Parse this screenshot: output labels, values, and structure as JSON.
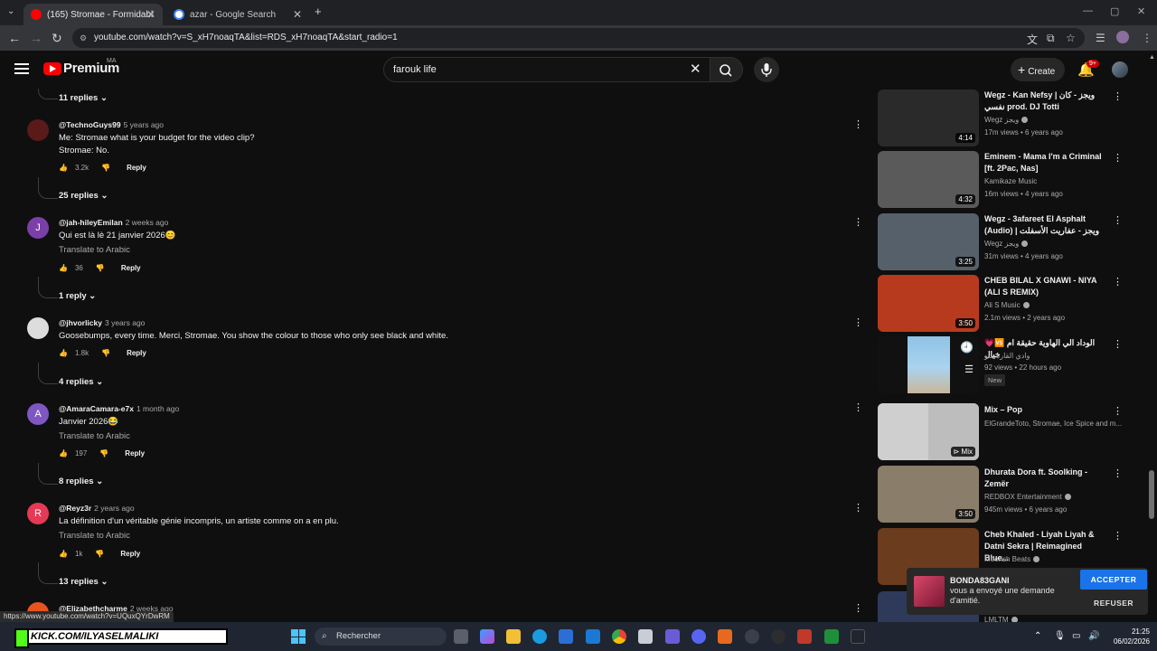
{
  "browser": {
    "tabs": [
      {
        "title": "(165) Stromae - Formidable (ce",
        "active": true
      },
      {
        "title": "azar - Google Search",
        "active": false
      }
    ],
    "new_tab": "+",
    "url": "youtube.com/watch?v=S_xH7noaqTA&list=RDS_xH7noaqTA&start_radio=1",
    "status_url": "https://www.youtube.com/watch?v=UQuxQYrDwRM"
  },
  "youtube": {
    "brand": "Premium",
    "region": "MA",
    "search_value": "farouk life",
    "create_label": "Create",
    "notif_count": "9+"
  },
  "comments": [
    {
      "replies_above": "11 replies"
    },
    {
      "author": "@TechnoGuys99",
      "time": "5 years ago",
      "lines": [
        "Me: Stromae what is your budget for the video clip?",
        "Stromae: No."
      ],
      "likes": "3.2k",
      "reply": "Reply",
      "replies": "25 replies",
      "avatar_color": "#5a1a1a",
      "avatar_letter": ""
    },
    {
      "author": "@jah-hileyEmilan",
      "time": "2 weeks ago",
      "lines": [
        "Qui est là lè 21 janvier 2026😊"
      ],
      "translate": "Translate to Arabic",
      "likes": "36",
      "reply": "Reply",
      "replies": "1 reply",
      "avatar_color": "#7b3fa8",
      "avatar_letter": "J"
    },
    {
      "author": "@jhvorlicky",
      "time": "3 years ago",
      "lines": [
        "Goosebumps, every time. Merci, Stromae. You show the colour to those who only see black and white."
      ],
      "likes": "1.8k",
      "reply": "Reply",
      "replies": "4 replies",
      "avatar_color": "#dddddd",
      "avatar_letter": ""
    },
    {
      "author": "@AmaraCamara-e7x",
      "time": "1 month ago",
      "lines": [
        "Janvier 2026😂"
      ],
      "translate": "Translate to Arabic",
      "likes": "197",
      "reply": "Reply",
      "replies": "8 replies",
      "avatar_color": "#7e57c2",
      "avatar_letter": "A"
    },
    {
      "author": "@Reyz3r",
      "time": "2 years ago",
      "lines": [
        "La définition d'un véritable génie incompris, un artiste comme on a en plu."
      ],
      "translate": "Translate to Arabic",
      "likes": "1k",
      "reply": "Reply",
      "replies": "13 replies",
      "avatar_color": "#e53956",
      "avatar_letter": "R"
    },
    {
      "author": "@Elizabethcharme",
      "time": "2 weeks ago"
    }
  ],
  "recommended": [
    {
      "title": "Wegz - Kan Nefsy | ويجز - كان نفسي prod. DJ Totti",
      "channel": "Wegz ويجز",
      "verified": true,
      "meta": "17m views • 6 years ago",
      "duration": "4:14",
      "thumb_color": "#2a2a2a"
    },
    {
      "title": "Eminem - Mama I'm a Criminal [ft. 2Pac, Nas]",
      "channel": "Kamikaze Music",
      "verified": false,
      "meta": "16m views • 4 years ago",
      "duration": "4:32",
      "thumb_color": "#5a5a5a"
    },
    {
      "title": "Wegz - 3afareet El Asphalt (Audio) | ويجز - عفاريت الأسفلت",
      "channel": "Wegz ويجز",
      "verified": true,
      "meta": "31m views • 4 years ago",
      "duration": "3:25",
      "thumb_color": "#55606a"
    },
    {
      "title": "CHEB BILAL X GNAWI - NIYA (ALI S REMIX)",
      "channel": "Ali S Music",
      "verified": true,
      "meta": "2.1m views • 2 years ago",
      "duration": "3:50",
      "thumb_color": "#b83a1e"
    },
    {
      "title": "💗🆚 الوداد الي الهاوية حقيقة ام خيال",
      "channel": "وادي القارة سو",
      "verified": false,
      "meta": "92 views • 22 hours ago",
      "badge": "New",
      "duration": "",
      "thumb_color": "#111111"
    },
    {
      "title": "Mix – Pop",
      "channel": "ElGrandeToto, Stromae, Ice Spice and m...",
      "verified": false,
      "meta": "",
      "duration": "Mix",
      "thumb_color": "#d9d9d9"
    },
    {
      "title": "Dhurata Dora ft. Soolking - Zemër",
      "channel": "REDBOX Entertainment",
      "verified": true,
      "meta": "945m views • 6 years ago",
      "duration": "3:50",
      "thumb_color": "#8a7e6a"
    },
    {
      "title": "Cheb Khaled - Liyah Liyah & Datni Sekra | Reimagined Blue...",
      "channel": "Moorish Beats",
      "verified": true,
      "meta": "",
      "duration": "",
      "thumb_color": "#6b3c1e"
    },
    {
      "title": "",
      "channel": "LMLTM",
      "verified": true,
      "meta": "",
      "duration": "",
      "thumb_color": "#2f3a5a"
    }
  ],
  "toast": {
    "name": "BONDA83GANI",
    "message": "vous a envoyé une demande d'amitié.",
    "accept": "ACCEPTER",
    "refuse": "REFUSER"
  },
  "taskbar": {
    "overlay_text": "KICK.COM/ILYASELMALIKI",
    "search_placeholder": "Rechercher",
    "time": "21:25",
    "date": "06/02/2026"
  }
}
